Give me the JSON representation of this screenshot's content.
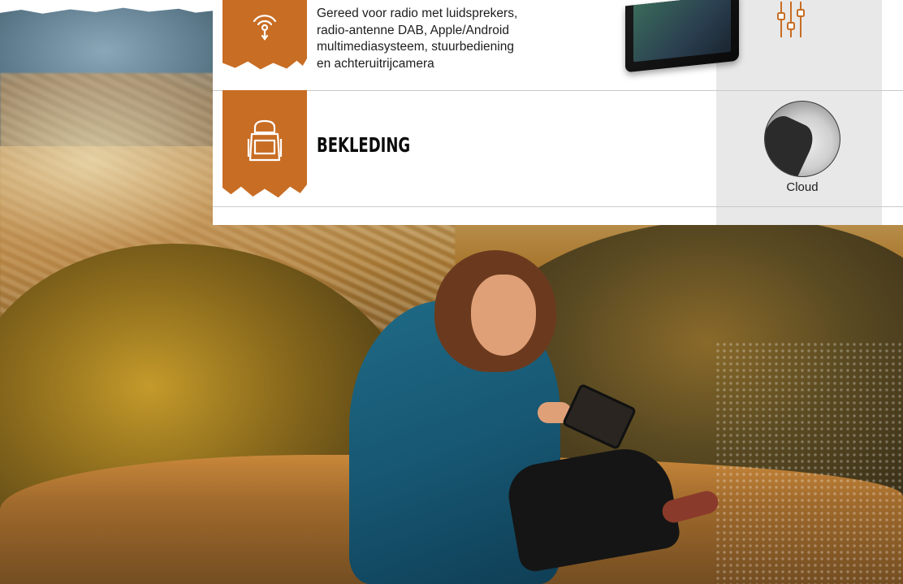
{
  "features": {
    "radio": {
      "icon": "radio-antenna-icon",
      "lines": [
        "Gereed voor radio met luidsprekers,",
        "radio-antenne DAB, Apple/Android",
        "multimediasysteem, stuurbediening",
        "en achteruitrijcamera"
      ],
      "option_icon": "equalizer-icon"
    },
    "upholstery": {
      "icon": "backpack-seat-icon",
      "heading": "BEKLEDING",
      "swatch_label": "Cloud"
    }
  },
  "colors": {
    "accent": "#c86d24",
    "panel": "#ffffff",
    "option_column": "#e8e8e8"
  }
}
